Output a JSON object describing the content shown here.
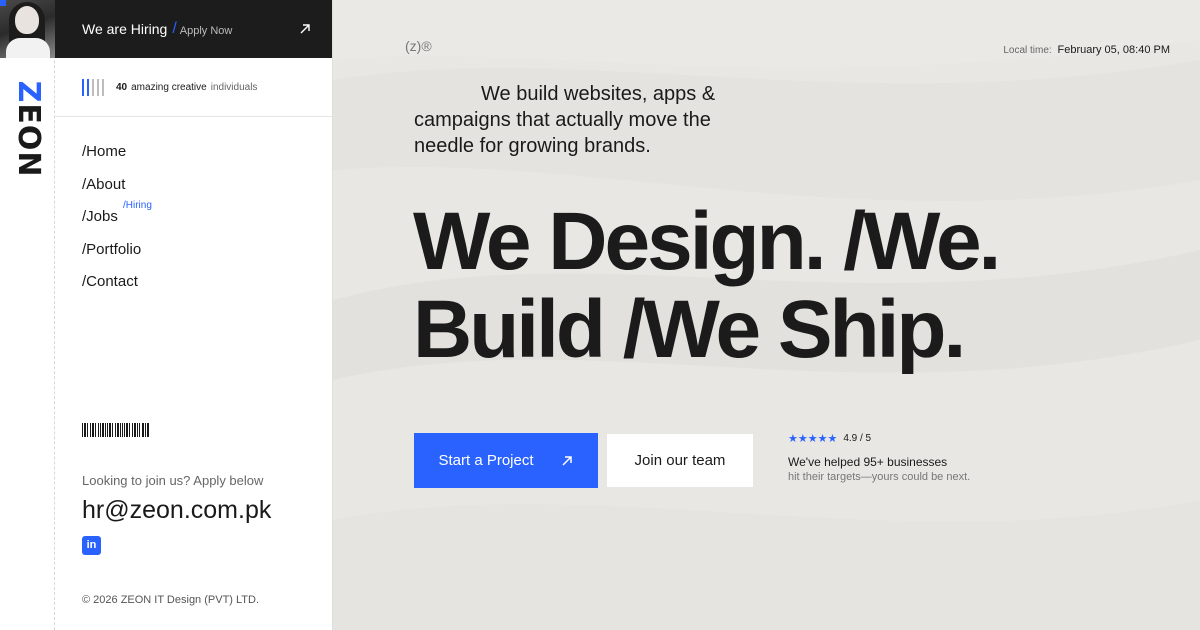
{
  "brand": {
    "logo_text": "ZEON",
    "accent_color": "#2962ff"
  },
  "hiring_banner": {
    "title": "We are Hiring",
    "separator": "/",
    "subtitle": "Apply Now",
    "icon": "arrow-up-right-icon"
  },
  "team": {
    "count": "40",
    "label": "amazing creative",
    "suffix": "individuals"
  },
  "nav": {
    "items": [
      {
        "label": "/Home"
      },
      {
        "label": "/About"
      },
      {
        "label": "/Jobs",
        "badge": "/Hiring"
      },
      {
        "label": "/Portfolio"
      },
      {
        "label": "/Contact"
      }
    ]
  },
  "contact": {
    "join_label": "Looking to join us? Apply below",
    "email": "hr@zeon.com.pk",
    "linkedin_icon": "linkedin-icon",
    "linkedin_text": "in"
  },
  "footer": {
    "copyright": "© 2026 ZEON IT Design (PVT) LTD."
  },
  "main": {
    "zmark": "(z)®",
    "local_time_label": "Local time:",
    "local_time_value": "February 05, 08:40 PM",
    "intro": "We build websites, apps & campaigns that actually move the needle for growing brands.",
    "headline_line1": "We Design. /We.",
    "headline_line2": "Build /We Ship.",
    "cta_primary": "Start a Project",
    "cta_secondary": "Join our team",
    "rating_stars": "★★★★★",
    "rating_value": "4.9 / 5",
    "helped": "We've helped 95+ businesses",
    "targets": "hit their targets—yours could be next."
  }
}
